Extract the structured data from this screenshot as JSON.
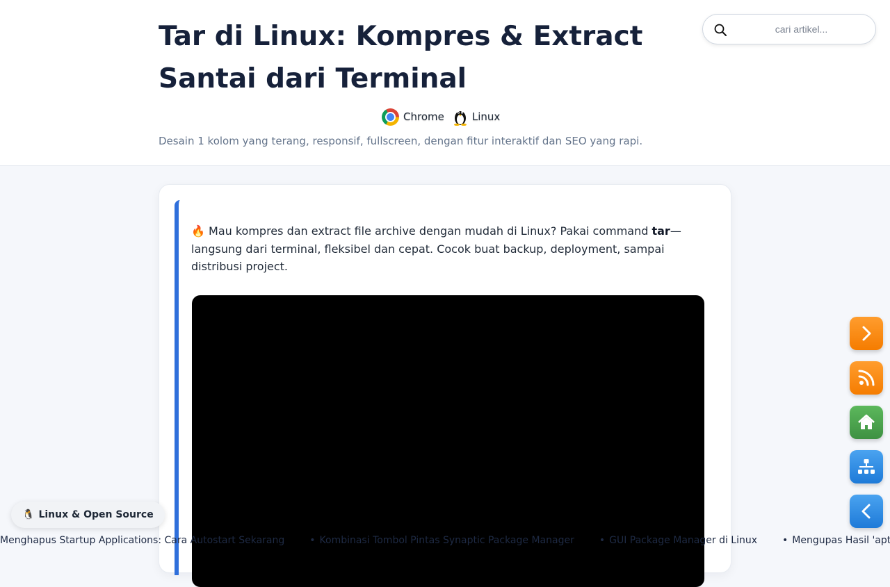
{
  "header": {
    "title": "Tar di Linux: Kompres & Extract Santai dari Terminal",
    "badges": [
      {
        "icon": "chrome-icon",
        "label": "Chrome"
      },
      {
        "icon": "tux-icon",
        "label": "Linux"
      }
    ],
    "subtitle": "Desain 1 kolom yang terang, responsif, fullscreen, dengan fitur interaktif dan SEO yang rapi."
  },
  "search": {
    "placeholder": "cari artikel...",
    "value": ""
  },
  "article": {
    "intro_emoji": "🔥",
    "intro_before": " Mau kompres dan extract file archive dengan mudah di Linux? Pakai command ",
    "intro_strong": "tar",
    "intro_after": "—langsung dari terminal, fleksibel dan cepat. Cocok buat backup, deployment, sampai distribusi project."
  },
  "floating_buttons": [
    {
      "icon": "chevron-right-icon",
      "color": "#f57c00"
    },
    {
      "icon": "rss-icon",
      "color": "#f57c00"
    },
    {
      "icon": "home-icon",
      "color": "#3e9142"
    },
    {
      "icon": "sitemap-icon",
      "color": "#1e7ad8"
    },
    {
      "icon": "chevron-left-icon",
      "color": "#1e7ad8"
    }
  ],
  "category_chip": {
    "emoji": "🐧",
    "label": "Linux & Open Source"
  },
  "ticker": {
    "items": [
      "Menghapus Startup Applications: Cara Autostart Sekarang",
      "Kombinasi Tombol Pintas Synaptic Package Manager",
      "GUI Package Manager di Linux",
      "Mengupas Hasil 'apt --aud"
    ]
  },
  "colors": {
    "accent": "#2f6fdb",
    "title": "#16213a",
    "orange": "#f57c00",
    "green": "#3e9142",
    "blue": "#1e7ad8"
  }
}
